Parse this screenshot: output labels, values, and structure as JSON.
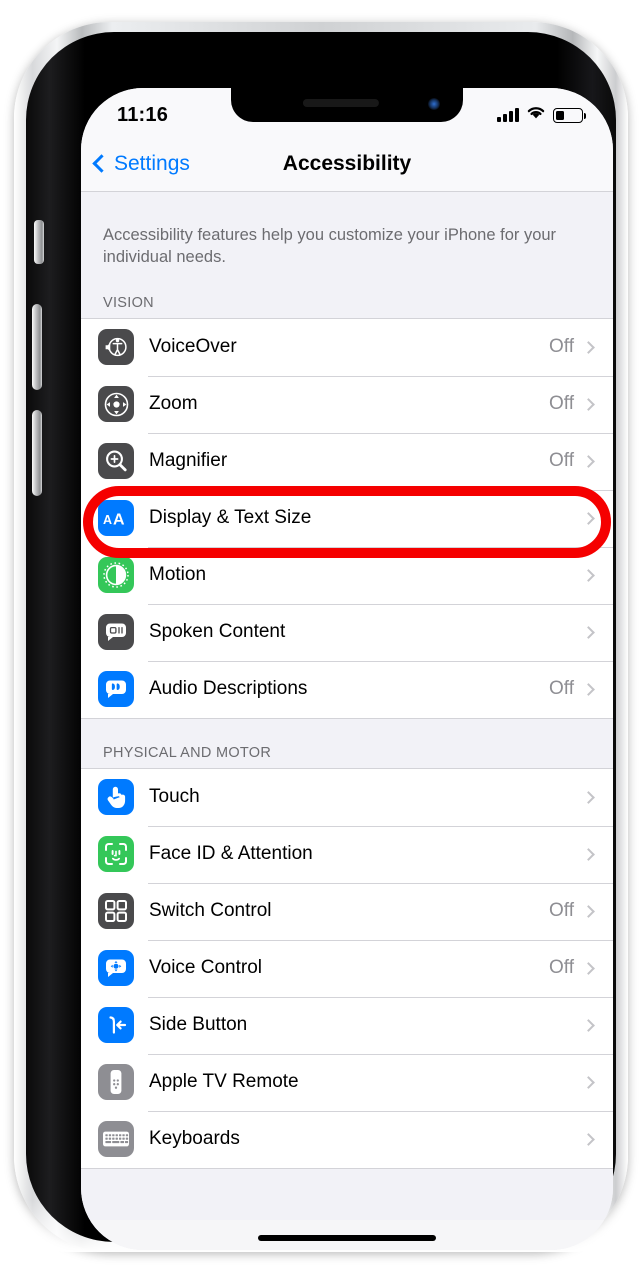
{
  "status_bar": {
    "time": "11:16",
    "signal_icon": "cellular-signal-icon",
    "wifi_icon": "wifi-icon",
    "battery_icon": "battery-icon",
    "battery_level_percent": 32
  },
  "nav": {
    "back_label": "Settings",
    "back_icon": "chevron-left-icon",
    "title": "Accessibility"
  },
  "intro": {
    "text": "Accessibility features help you customize your iPhone for your individual needs."
  },
  "sections": [
    {
      "header": "VISION",
      "rows": [
        {
          "label": "VoiceOver",
          "value": "Off",
          "icon": "voiceover-icon",
          "icon_style": "ic-dark"
        },
        {
          "label": "Zoom",
          "value": "Off",
          "icon": "zoom-icon",
          "icon_style": "ic-dark"
        },
        {
          "label": "Magnifier",
          "value": "Off",
          "icon": "magnifier-icon",
          "icon_style": "ic-dark"
        },
        {
          "label": "Display & Text Size",
          "value": "",
          "icon": "display-text-size-icon",
          "icon_style": "ic-blue"
        },
        {
          "label": "Motion",
          "value": "",
          "icon": "motion-icon",
          "icon_style": "ic-green"
        },
        {
          "label": "Spoken Content",
          "value": "",
          "icon": "spoken-content-icon",
          "icon_style": "ic-dark"
        },
        {
          "label": "Audio Descriptions",
          "value": "Off",
          "icon": "audio-descriptions-icon",
          "icon_style": "ic-blue"
        }
      ]
    },
    {
      "header": "PHYSICAL AND MOTOR",
      "rows": [
        {
          "label": "Touch",
          "value": "",
          "icon": "touch-icon",
          "icon_style": "ic-blue"
        },
        {
          "label": "Face ID & Attention",
          "value": "",
          "icon": "face-id-icon",
          "icon_style": "ic-green"
        },
        {
          "label": "Switch Control",
          "value": "Off",
          "icon": "switch-control-icon",
          "icon_style": "ic-dark"
        },
        {
          "label": "Voice Control",
          "value": "Off",
          "icon": "voice-control-icon",
          "icon_style": "ic-blue"
        },
        {
          "label": "Side Button",
          "value": "",
          "icon": "side-button-icon",
          "icon_style": "ic-blue"
        },
        {
          "label": "Apple TV Remote",
          "value": "",
          "icon": "apple-tv-remote-icon",
          "icon_style": "ic-gray"
        },
        {
          "label": "Keyboards",
          "value": "",
          "icon": "keyboards-icon",
          "icon_style": "ic-gray"
        }
      ]
    }
  ],
  "annotation": {
    "shape": "rounded-rectangle-highlight",
    "color": "#f50000",
    "targets_row_label": "Display & Text Size"
  },
  "colors": {
    "accent_blue": "#007aff",
    "green": "#34c759",
    "dark_icon": "#4a4a4c",
    "gray_icon": "#8e8e93",
    "value_gray": "#8e8e93",
    "group_bg": "#ffffff",
    "page_bg": "#f2f2f7",
    "annotation_red": "#f50000"
  }
}
